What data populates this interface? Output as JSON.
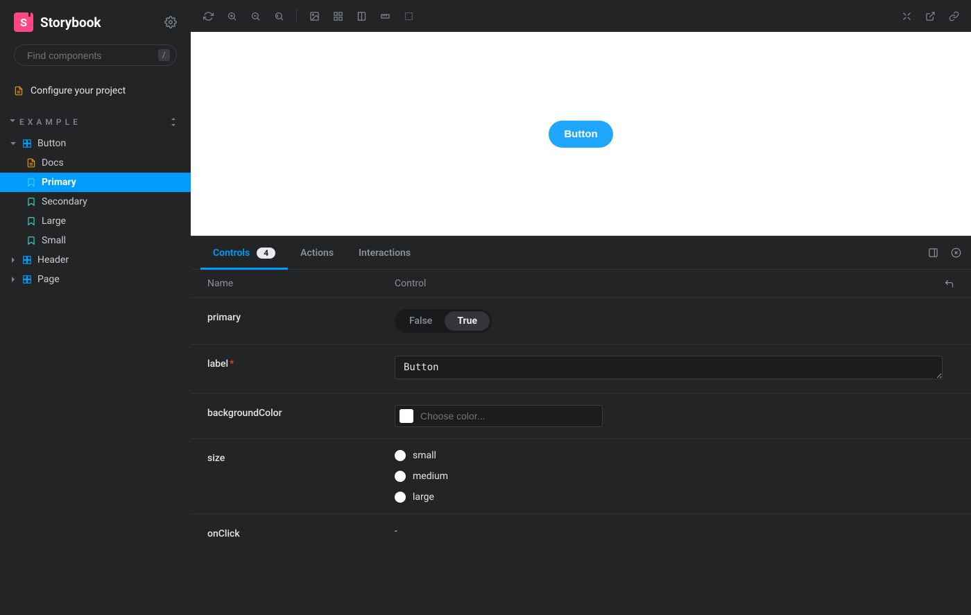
{
  "brand": {
    "name": "Storybook",
    "logo_letter": "S"
  },
  "search": {
    "placeholder": "Find components",
    "shortcut": "/"
  },
  "config_link": "Configure your project",
  "group": "EXAMPLE",
  "tree": {
    "button": {
      "label": "Button",
      "children": [
        {
          "id": "docs",
          "label": "Docs",
          "type": "doc"
        },
        {
          "id": "primary",
          "label": "Primary",
          "type": "story",
          "active": true
        },
        {
          "id": "secondary",
          "label": "Secondary",
          "type": "story"
        },
        {
          "id": "large",
          "label": "Large",
          "type": "story"
        },
        {
          "id": "small",
          "label": "Small",
          "type": "story"
        }
      ]
    },
    "header": {
      "label": "Header"
    },
    "page": {
      "label": "Page"
    }
  },
  "canvas": {
    "button_label": "Button"
  },
  "tabs": {
    "controls": "Controls",
    "badge": "4",
    "actions": "Actions",
    "interactions": "Interactions"
  },
  "controls_head": {
    "name": "Name",
    "control": "Control"
  },
  "controls": {
    "primary": {
      "name": "primary",
      "false": "False",
      "true": "True",
      "value": true
    },
    "label": {
      "name": "label",
      "value": "Button",
      "required": true
    },
    "bg": {
      "name": "backgroundColor",
      "placeholder": "Choose color..."
    },
    "size": {
      "name": "size",
      "options": [
        "small",
        "medium",
        "large"
      ]
    },
    "onClick": {
      "name": "onClick",
      "value": "-"
    }
  }
}
